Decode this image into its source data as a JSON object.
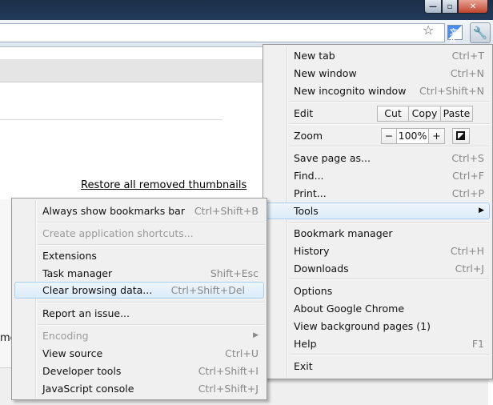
{
  "window": {
    "min": "—",
    "max": "▫",
    "close": "✕"
  },
  "toolbar": {
    "star": "☆",
    "translate": "文A",
    "wrench": "🔧"
  },
  "page": {
    "restore_link": "Restore all removed thumbnails",
    "partial_text": "me"
  },
  "main_menu": {
    "new_tab": {
      "label": "New tab",
      "shortcut": "Ctrl+T"
    },
    "new_window": {
      "label": "New window",
      "shortcut": "Ctrl+N"
    },
    "new_incognito": {
      "label": "New incognito window",
      "shortcut": "Ctrl+Shift+N"
    },
    "edit": {
      "label": "Edit",
      "cut": "Cut",
      "copy": "Copy",
      "paste": "Paste"
    },
    "zoom": {
      "label": "Zoom",
      "minus": "−",
      "level": "100%",
      "plus": "+"
    },
    "save_page": {
      "label": "Save page as...",
      "shortcut": "Ctrl+S"
    },
    "find": {
      "label": "Find...",
      "shortcut": "Ctrl+F"
    },
    "print": {
      "label": "Print...",
      "shortcut": "Ctrl+P"
    },
    "tools": {
      "label": "Tools",
      "arrow": "▶"
    },
    "bookmark_manager": {
      "label": "Bookmark manager"
    },
    "history": {
      "label": "History",
      "shortcut": "Ctrl+H"
    },
    "downloads": {
      "label": "Downloads",
      "shortcut": "Ctrl+J"
    },
    "options": {
      "label": "Options"
    },
    "about": {
      "label": "About Google Chrome"
    },
    "background_pages": {
      "label": "View background pages (1)"
    },
    "help": {
      "label": "Help",
      "shortcut": "F1"
    },
    "exit": {
      "label": "Exit"
    }
  },
  "tools_menu": {
    "bookmarks_bar": {
      "label": "Always show bookmarks bar",
      "shortcut": "Ctrl+Shift+B"
    },
    "app_shortcuts": {
      "label": "Create application shortcuts..."
    },
    "extensions": {
      "label": "Extensions"
    },
    "task_manager": {
      "label": "Task manager",
      "shortcut": "Shift+Esc"
    },
    "clear_browsing": {
      "label": "Clear browsing data...",
      "shortcut": "Ctrl+Shift+Del"
    },
    "report_issue": {
      "label": "Report an issue..."
    },
    "encoding": {
      "label": "Encoding",
      "arrow": "▶"
    },
    "view_source": {
      "label": "View source",
      "shortcut": "Ctrl+U"
    },
    "developer_tools": {
      "label": "Developer tools",
      "shortcut": "Ctrl+Shift+I"
    },
    "js_console": {
      "label": "JavaScript console",
      "shortcut": "Ctrl+Shift+J"
    }
  }
}
